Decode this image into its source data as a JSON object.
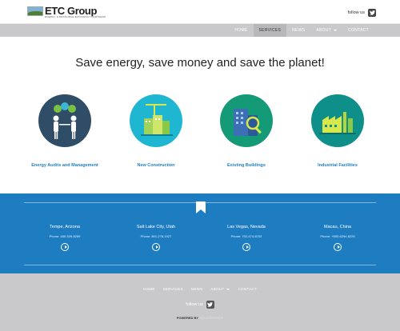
{
  "header": {
    "logo_text": "ETC Group",
    "logo_tagline": "ENERGY & RESOURCE EFFICIENCY PARTNERS",
    "follow_label": "follow us"
  },
  "nav": {
    "items": [
      {
        "label": "HOME"
      },
      {
        "label": "SERVICES",
        "active": true
      },
      {
        "label": "NEWS"
      },
      {
        "label": "ABOUT",
        "has_dropdown": true
      },
      {
        "label": "CONTACT"
      }
    ]
  },
  "hero": {
    "headline": "Save energy, save money and save the planet!"
  },
  "services": [
    {
      "label": "Energy Audits and Management",
      "icon": "people-energy-icon",
      "color": "#2f4d66"
    },
    {
      "label": "New Construction",
      "icon": "construction-crane-icon",
      "color": "#1fb6d1"
    },
    {
      "label": "Existing Buildings",
      "icon": "building-magnifier-icon",
      "color": "#159a77"
    },
    {
      "label": "Industrial Facilities",
      "icon": "factory-icon",
      "color": "#0f8f8a"
    }
  ],
  "offices": [
    {
      "city": "Tempe, Arizona",
      "phone": "Phone: 480-339-8289"
    },
    {
      "city": "Salt Lake City, Utah",
      "phone": "Phone: 801-278-1927"
    },
    {
      "city": "Las Vegas, Nevada",
      "phone": "Phone: 702-474-6702"
    },
    {
      "city": "Macau, China",
      "phone": "Phone: +853-6294-8225"
    }
  ],
  "footer": {
    "nav": [
      {
        "label": "HOME"
      },
      {
        "label": "SERVICES"
      },
      {
        "label": "NEWS"
      },
      {
        "label": "ABOUT",
        "has_dropdown": true
      },
      {
        "label": "CONTACT"
      }
    ],
    "follow_label": "follow us",
    "powered_prefix": "POWERED BY",
    "powered_brand": "SQUARESPACE"
  },
  "colors": {
    "accent_blue": "#1e7dc1",
    "link_blue": "#1f7fc2",
    "nav_gray": "#c9c9cc"
  }
}
